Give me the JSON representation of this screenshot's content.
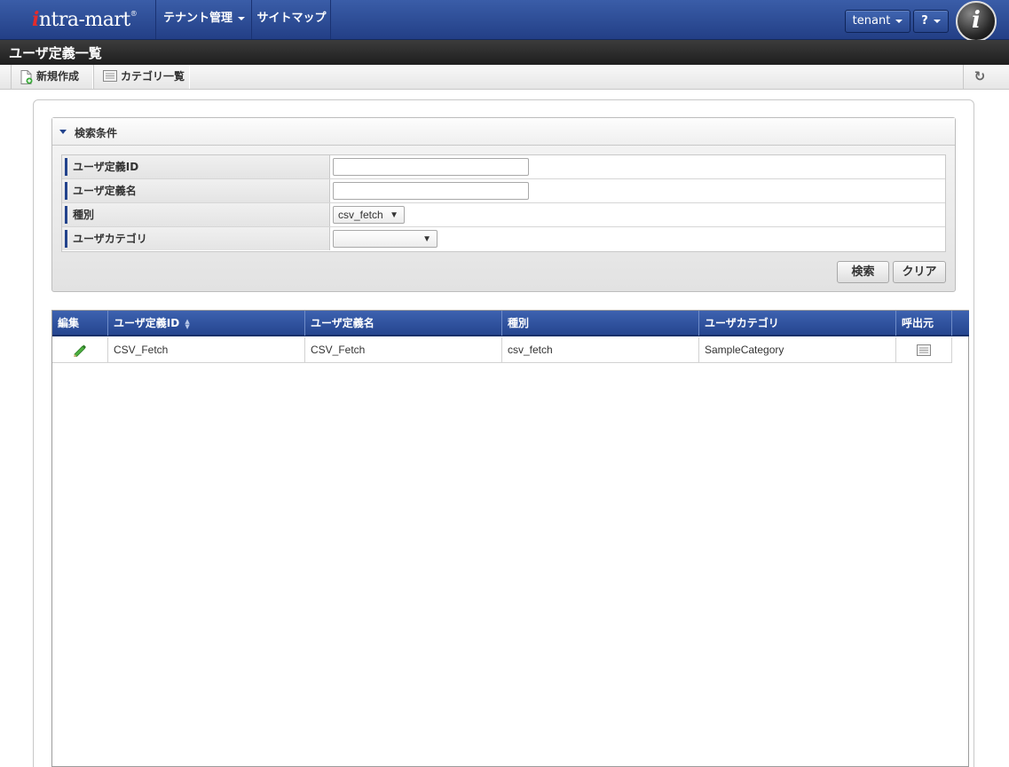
{
  "header": {
    "logo_text_i": "i",
    "logo_text_rest": "ntra-mart",
    "logo_reg": "®",
    "nav": [
      {
        "label": "テナント管理",
        "dropdown": true
      },
      {
        "label": "サイトマップ",
        "dropdown": false
      }
    ],
    "tenant_label": "tenant",
    "help_label": "?",
    "info_label": "i"
  },
  "titlebar": {
    "title": "ユーザ定義一覧"
  },
  "toolbar": {
    "new_label": "新規作成",
    "category_label": "カテゴリ一覧",
    "refresh_icon": "↻"
  },
  "search": {
    "title": "検索条件",
    "fields": [
      {
        "label": "ユーザ定義ID",
        "value": ""
      },
      {
        "label": "ユーザ定義名",
        "value": ""
      },
      {
        "label": "種別",
        "value": "csv_fetch"
      },
      {
        "label": "ユーザカテゴリ",
        "value": ""
      }
    ],
    "search_button": "検索",
    "clear_button": "クリア"
  },
  "grid": {
    "columns": [
      "編集",
      "ユーザ定義ID",
      "ユーザ定義名",
      "種別",
      "ユーザカテゴリ",
      "呼出元"
    ],
    "rows": [
      {
        "id": "CSV_Fetch",
        "name": "CSV_Fetch",
        "type": "csv_fetch",
        "category": "SampleCategory"
      }
    ]
  },
  "colors": {
    "header_blue": "#2b4a94",
    "accent_blue": "#23438c",
    "title_black": "#2a2a2a"
  }
}
